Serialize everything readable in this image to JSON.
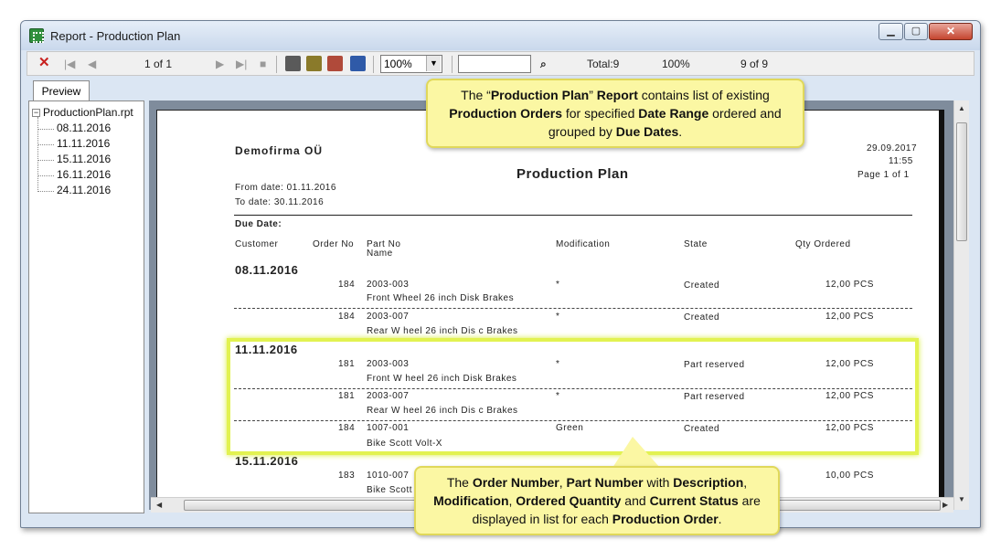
{
  "window": {
    "title": "Report - Production Plan"
  },
  "toolbar": {
    "page_indicator": "1 of 1",
    "zoom": "100%",
    "total": "Total:9",
    "percent": "100%",
    "records": "9 of 9"
  },
  "tabs": {
    "preview": "Preview"
  },
  "tree": {
    "root": "ProductionPlan.rpt",
    "items": [
      "08.11.2016",
      "11.11.2016",
      "15.11.2016",
      "16.11.2016",
      "24.11.2016"
    ]
  },
  "report": {
    "company": "Demofirma OÜ",
    "title": "Production Plan",
    "date": "29.09.2017",
    "time": "11:55",
    "page": "Page 1 of 1",
    "from": "From date: 01.11.2016",
    "to": "To date: 30.11.2016",
    "due_date_label": "Due Date:",
    "columns": {
      "customer": "Customer",
      "order_no": "Order No",
      "part_no": "Part No",
      "name": "Name",
      "modification": "Modification",
      "state": "State",
      "qty": "Qty Ordered"
    },
    "groups": [
      {
        "date": "08.11.2016",
        "rows": [
          {
            "order": "184",
            "part": "2003-003",
            "desc": "Front Wheel 26 inch Disk Brakes",
            "mod": "*",
            "state": "Created",
            "qty": "12,00 PCS"
          },
          {
            "order": "184",
            "part": "2003-007",
            "desc": "Rear W heel 26 inch Dis c Brakes",
            "mod": "*",
            "state": "Created",
            "qty": "12,00 PCS"
          }
        ]
      },
      {
        "date": "11.11.2016",
        "rows": [
          {
            "order": "181",
            "part": "2003-003",
            "desc": "Front W heel 26 inch Disk Brakes",
            "mod": "*",
            "state": "Part reserved",
            "qty": "12,00 PCS"
          },
          {
            "order": "181",
            "part": "2003-007",
            "desc": "Rear W heel 26 inch Dis c Brakes",
            "mod": "*",
            "state": "Part reserved",
            "qty": "12,00 PCS"
          },
          {
            "order": "184",
            "part": "1007-001",
            "desc": "Bike Scott Volt-X",
            "mod": "Green",
            "state": "Created",
            "qty": "12,00 PCS"
          }
        ]
      },
      {
        "date": "15.11.2016",
        "rows": [
          {
            "order": "183",
            "part": "1010-007",
            "desc": "Bike Scott",
            "mod": "",
            "state": "",
            "qty": "10,00 PCS"
          }
        ]
      }
    ]
  },
  "callouts": {
    "top": {
      "p1": "The “",
      "b1": "Production Plan",
      "p2": "” ",
      "b2": "Report",
      "p3": " contains list of existing ",
      "b3": "Production Orders",
      "p4": " for specified ",
      "b4": "Date Range",
      "p5": " ordered and grouped by ",
      "b5": "Due Dates",
      "p6": "."
    },
    "bottom": {
      "p1": "The ",
      "b1": "Order Number",
      "p2": ", ",
      "b2": "Part Number",
      "p3": " with ",
      "b3": "Description",
      "p4": ", ",
      "b4": "Modification",
      "p5": ", ",
      "b5": "Ordered Quantity",
      "p6": " and ",
      "b6": "Current Status",
      "p7": " are displayed in list for each ",
      "b7": "Production Order",
      "p8": "."
    }
  },
  "colors": {
    "accent_highlight": "#e2f251",
    "callout_bg": "#fbf7a3",
    "close_red": "#c8201e"
  }
}
